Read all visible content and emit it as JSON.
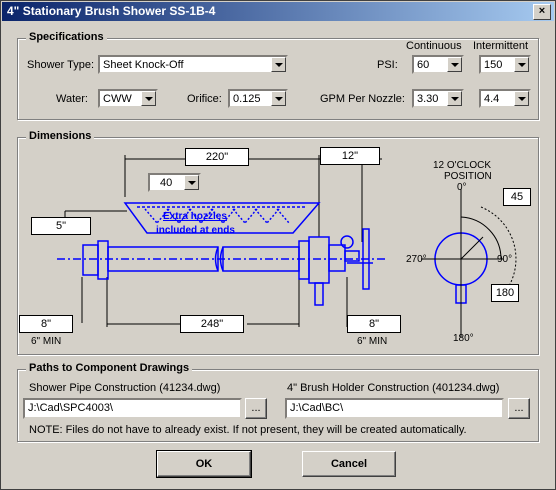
{
  "window": {
    "title": "4\" Stationary Brush Shower SS-1B-4",
    "close_glyph": "×"
  },
  "specs": {
    "group_label": "Specifications",
    "continuous_header": "Continuous",
    "intermittent_header": "Intermittent",
    "shower_type_label": "Shower Type:",
    "shower_type_value": "Sheet Knock-Off",
    "psi_label": "PSI:",
    "psi_continuous": "60",
    "psi_intermittent": "150",
    "water_label": "Water:",
    "water_value": "CWW",
    "orifice_label": "Orifice:",
    "orifice_value": "0.125",
    "gpm_label": "GPM Per Nozzle:",
    "gpm_continuous": "3.30",
    "gpm_intermittent": "4.4"
  },
  "dimensions": {
    "group_label": "Dimensions",
    "overall_length": "220\"",
    "right_extension": "12\"",
    "nozzle_count": "40",
    "height": "5\"",
    "left_offset": "8\"",
    "pipe_length": "248\"",
    "right_offset": "8\"",
    "min_left": "6\" MIN",
    "min_right": "6\" MIN",
    "nozzle_note_line1": "Extra nozzles",
    "nozzle_note_line2": "included at ends",
    "clock_title_line1": "12 O'CLOCK",
    "clock_title_line2": "POSITION",
    "angle_0": "0°",
    "angle_90": "90°",
    "angle_180": "180°",
    "angle_270": "270°",
    "angle_from": "45",
    "angle_to": "180",
    "colors": {
      "drawing": "#0000ff",
      "line": "#000000"
    }
  },
  "paths": {
    "group_label": "Paths to Component Drawings",
    "pipe_label": "Shower Pipe Construction (41234.dwg)",
    "pipe_value": "J:\\Cad\\SPC4003\\",
    "holder_label": "4\" Brush Holder Construction (401234.dwg)",
    "holder_value": "J:\\Cad\\BC\\",
    "browse_label": "...",
    "note": "NOTE:  Files do not have to already exist.  If not present, they will be created automatically."
  },
  "buttons": {
    "ok": "OK",
    "cancel": "Cancel"
  }
}
